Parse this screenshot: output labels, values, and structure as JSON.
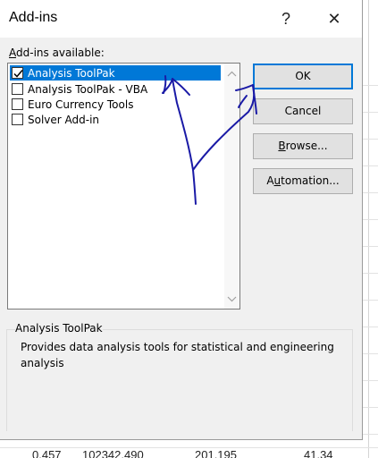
{
  "dialog": {
    "title": "Add-ins",
    "help_glyph": "?",
    "close_glyph": "✕"
  },
  "addins_label": {
    "prefix": "",
    "accel": "A",
    "rest": "dd-ins available:"
  },
  "addins": [
    {
      "label": "Analysis ToolPak",
      "checked": true,
      "selected": true
    },
    {
      "label": "Analysis ToolPak - VBA",
      "checked": false,
      "selected": false
    },
    {
      "label": "Euro Currency Tools",
      "checked": false,
      "selected": false
    },
    {
      "label": "Solver Add-in",
      "checked": false,
      "selected": false
    }
  ],
  "buttons": {
    "ok": "OK",
    "cancel": "Cancel",
    "browse_accel": "B",
    "browse_rest": "rowse...",
    "automation_pre": "A",
    "automation_accel": "u",
    "automation_rest": "tomation..."
  },
  "description": {
    "group_title": "Analysis ToolPak",
    "text": "Provides data analysis tools for statistical and engineering analysis"
  },
  "background_sheet": {
    "row_cells": [
      "0.457",
      "102342.490",
      "201.195",
      "41.34"
    ]
  },
  "colors": {
    "selection": "#0078d7",
    "annotation_ink": "#1a1aa6"
  }
}
